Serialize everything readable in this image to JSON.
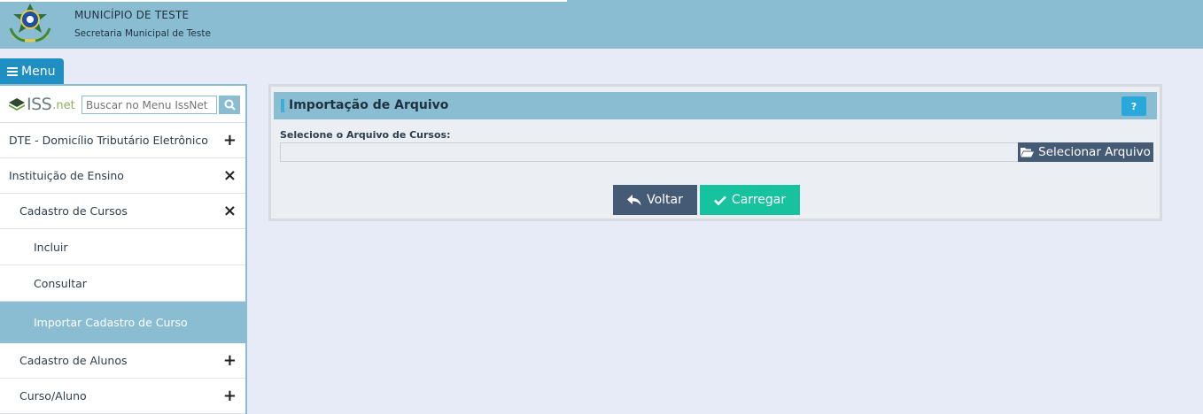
{
  "header": {
    "municipality": "MUNICÍPIO DE TESTE",
    "department": "Secretaria Municipal de Teste",
    "emblem_icon": "coat-of-arms-icon"
  },
  "menu_button": {
    "label": "Menu",
    "icon": "hamburger-icon"
  },
  "sidebar": {
    "logo": {
      "text": "ISS",
      "suffix": ".net"
    },
    "search": {
      "placeholder": "Buscar no Menu IssNet",
      "icon": "search-icon"
    },
    "items": [
      {
        "label": "DTE - Domicílio Tributário Eletrônico",
        "level": 1,
        "sign": "+"
      },
      {
        "label": "Instituição de Ensino",
        "level": 1,
        "sign": "×"
      },
      {
        "label": "Cadastro de Cursos",
        "level": 2,
        "sign": "×"
      },
      {
        "label": "Incluir",
        "level": 3,
        "sign": ""
      },
      {
        "label": "Consultar",
        "level": 3,
        "sign": ""
      },
      {
        "label": "Importar Cadastro de Curso",
        "level": 3,
        "sign": "",
        "active": true
      },
      {
        "label": "Cadastro de Alunos",
        "level": 2,
        "sign": "+"
      },
      {
        "label": "Curso/Aluno",
        "level": 2,
        "sign": "+"
      }
    ]
  },
  "panel": {
    "title": "Importação de Arquivo",
    "help_label": "?",
    "field_label": "Selecione o Arquivo de Cursos:",
    "file_value": "",
    "select_button": "Selecionar Arquivo",
    "back_button": "Voltar",
    "load_button": "Carregar"
  },
  "colors": {
    "header_bg": "#8abdd1",
    "page_bg": "#e6ebf7",
    "menu_button": "#1f8ec3",
    "dark_button": "#455a74",
    "success_button": "#17c39f",
    "help_button": "#29a8da"
  }
}
